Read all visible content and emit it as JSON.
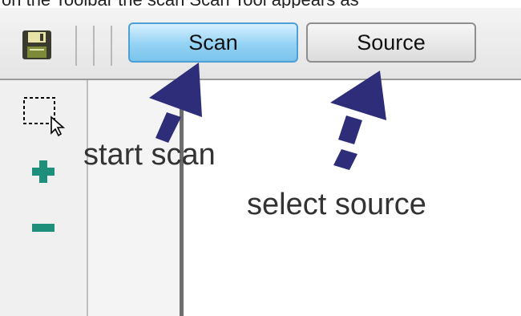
{
  "top_text": "    on the Toolbar the scan Scan Tool appears as",
  "toolbar": {
    "save_icon": "floppy-disk-save-icon",
    "buttons": [
      {
        "label": "Scan",
        "state": "active"
      },
      {
        "label": "Source",
        "state": "normal"
      }
    ]
  },
  "left_toolbar": {
    "icons": [
      "rectangle-select-icon",
      "zoom-in-icon",
      "zoom-out-icon"
    ]
  },
  "annotations": {
    "start_scan": "start scan",
    "select_source": "select source"
  },
  "colors": {
    "active_button": "#93d2f4",
    "active_border": "#4da0d6",
    "arrow": "#2e2d7a",
    "plus_icon": "#1e8f7a",
    "minus_icon": "#1e8f7a"
  }
}
